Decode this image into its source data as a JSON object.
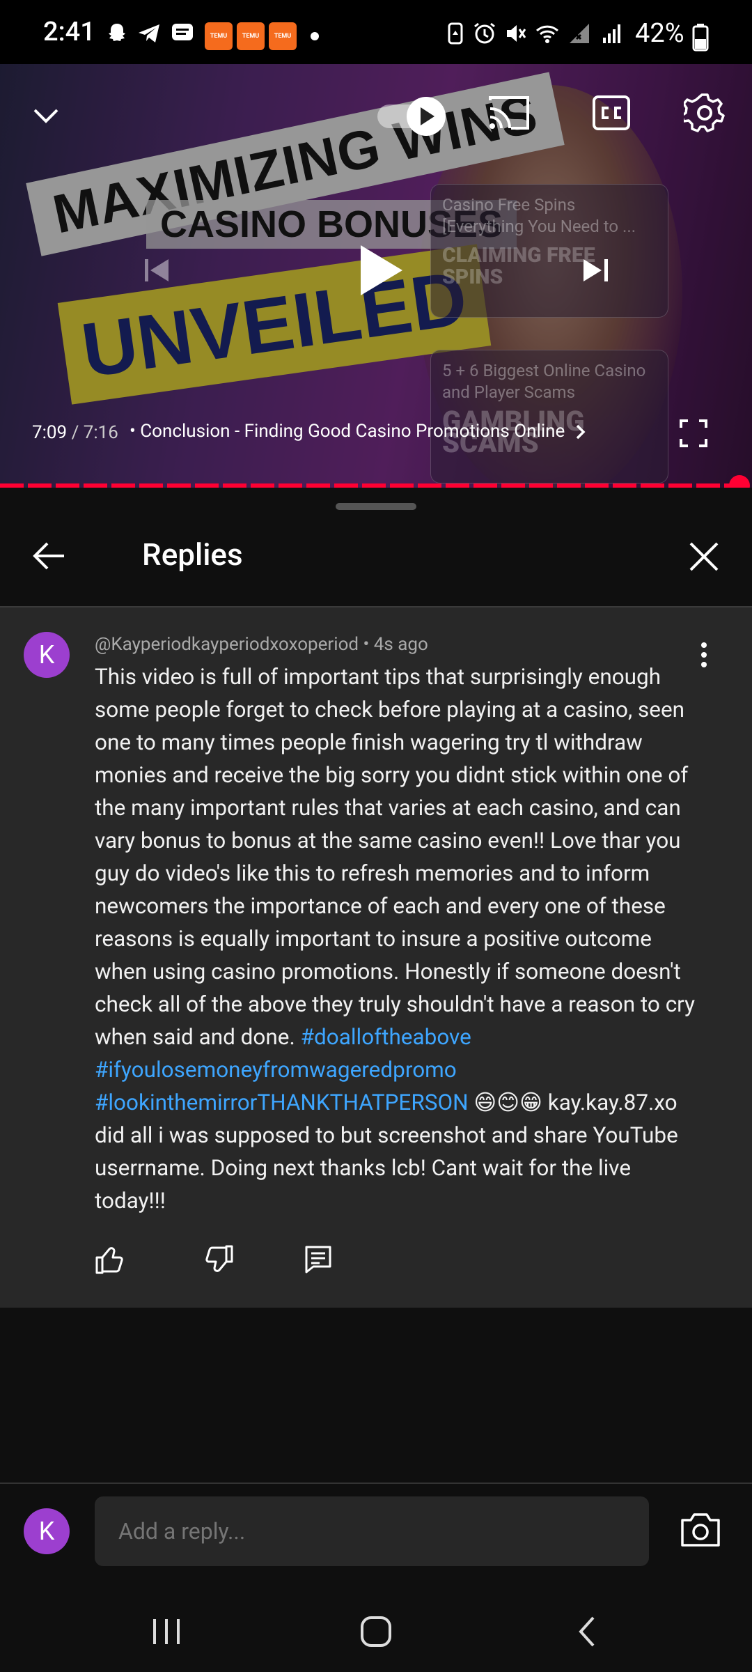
{
  "status_bar": {
    "time": "2:41",
    "battery_percent": "42%",
    "app_badge_text": "TEMU"
  },
  "video": {
    "thumbnail_text": {
      "line1": "MAXIMIZING WINS",
      "line2": "CASINO BONUSES",
      "line3": "UNVEILED"
    },
    "cards": [
      {
        "title": "Casino Free Spins [Everything You Need to ...",
        "badge": "CLAIMING FREE SPINS"
      },
      {
        "title": "5 + 6 Biggest Online Casino and Player Scams",
        "badge": "GAMBLING SCAMS"
      }
    ],
    "current_time": "7:09",
    "duration": "/ 7:16",
    "separator": "•",
    "chapter": "Conclusion - Finding Good Casino Promotions Online",
    "progress_fraction": 0.983
  },
  "replies_panel": {
    "title": "Replies"
  },
  "comment": {
    "avatar_letter": "K",
    "author": "@Kayperiodkayperiodxoxoperiod",
    "time_ago": "4s ago",
    "text_main": "This video is full of important tips that surprisingly enough some people forget to check before playing at a casino, seen one to many times people finish wagering try tl withdraw monies and receive the big sorry you didnt stick within one of the many important rules that varies at each casino, and can vary bonus to bonus at the same casino even!! Love thar you guy do video's like this to refresh memories and to inform newcomers the importance of each and every one of these reasons is equally important to insure a positive outcome when using casino promotions. Honestly if someone doesn't check all of the above they truly shouldn't have a reason to cry when said and done.",
    "hashtag1": "#doalloftheabove",
    "hashtag2": "#ifyoulosemoneyfromwageredpromo",
    "hashtag3": "#lookinthemirrorTHANKTHATPERSON",
    "text_end": "😄😊😁 kay.kay.87.xo did all i was supposed to but screenshot and share YouTube userrname. Doing next thanks lcb! Cant wait for the live today!!!"
  },
  "reply_bar": {
    "avatar_letter": "K",
    "placeholder": "Add a reply..."
  },
  "colors": {
    "accent_red": "#ff0033",
    "link_blue": "#3ea6ff",
    "avatar_purple": "#9c3fcf"
  }
}
